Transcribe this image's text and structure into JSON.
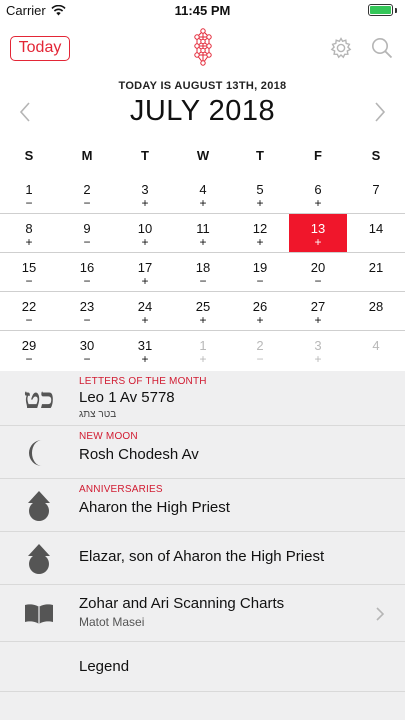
{
  "status_bar": {
    "carrier": "Carrier",
    "time": "11:45 PM"
  },
  "header": {
    "today_button": "Today"
  },
  "calendar": {
    "today_line": "TODAY IS AUGUST 13TH, 2018",
    "month_title": "JULY 2018",
    "weekdays": [
      "S",
      "M",
      "T",
      "W",
      "T",
      "F",
      "S"
    ],
    "weeks": [
      [
        {
          "d": "1",
          "m": "−"
        },
        {
          "d": "2",
          "m": "−"
        },
        {
          "d": "3",
          "m": "+"
        },
        {
          "d": "4",
          "m": "+"
        },
        {
          "d": "5",
          "m": "+"
        },
        {
          "d": "6",
          "m": "+"
        },
        {
          "d": "7",
          "m": ""
        }
      ],
      [
        {
          "d": "8",
          "m": "+"
        },
        {
          "d": "9",
          "m": "−"
        },
        {
          "d": "10",
          "m": "+"
        },
        {
          "d": "11",
          "m": "+"
        },
        {
          "d": "12",
          "m": "+"
        },
        {
          "d": "13",
          "m": "+"
        },
        {
          "d": "14",
          "m": ""
        }
      ],
      [
        {
          "d": "15",
          "m": "−"
        },
        {
          "d": "16",
          "m": "−"
        },
        {
          "d": "17",
          "m": "+"
        },
        {
          "d": "18",
          "m": "−"
        },
        {
          "d": "19",
          "m": "−"
        },
        {
          "d": "20",
          "m": "−"
        },
        {
          "d": "21",
          "m": ""
        }
      ],
      [
        {
          "d": "22",
          "m": "−"
        },
        {
          "d": "23",
          "m": "−"
        },
        {
          "d": "24",
          "m": "+"
        },
        {
          "d": "25",
          "m": "+"
        },
        {
          "d": "26",
          "m": "+"
        },
        {
          "d": "27",
          "m": "+"
        },
        {
          "d": "28",
          "m": ""
        }
      ],
      [
        {
          "d": "29",
          "m": "−"
        },
        {
          "d": "30",
          "m": "−"
        },
        {
          "d": "31",
          "m": "+"
        },
        {
          "d": "1",
          "m": "+"
        },
        {
          "d": "2",
          "m": "−"
        },
        {
          "d": "3",
          "m": "+"
        },
        {
          "d": "4",
          "m": ""
        }
      ]
    ],
    "selected_day": "13",
    "colors": {
      "accent": "#f0162b",
      "dim": "#b9b9b9"
    }
  },
  "list": {
    "letters": {
      "category": "LETTERS OF THE MONTH",
      "title": "Leo 1 Av 5778",
      "hebrew_sub": "בטר צתג",
      "icon_glyph": "כט",
      "icon": "hebrew-letters-icon"
    },
    "new_moon": {
      "category": "NEW MOON",
      "title": "Rosh Chodesh Av",
      "icon": "crescent-moon-icon"
    },
    "anniversary_1": {
      "category": "ANNIVERSARIES",
      "title": "Aharon the High Priest",
      "icon": "arrow-up-circle-icon"
    },
    "anniversary_2": {
      "title": "Elazar, son of Aharon the High Priest",
      "icon": "arrow-up-circle-icon"
    },
    "zohar": {
      "title": "Zohar and Ari Scanning Charts",
      "subtitle": "Matot Masei",
      "icon": "open-book-icon"
    },
    "legend": {
      "title": "Legend"
    }
  }
}
